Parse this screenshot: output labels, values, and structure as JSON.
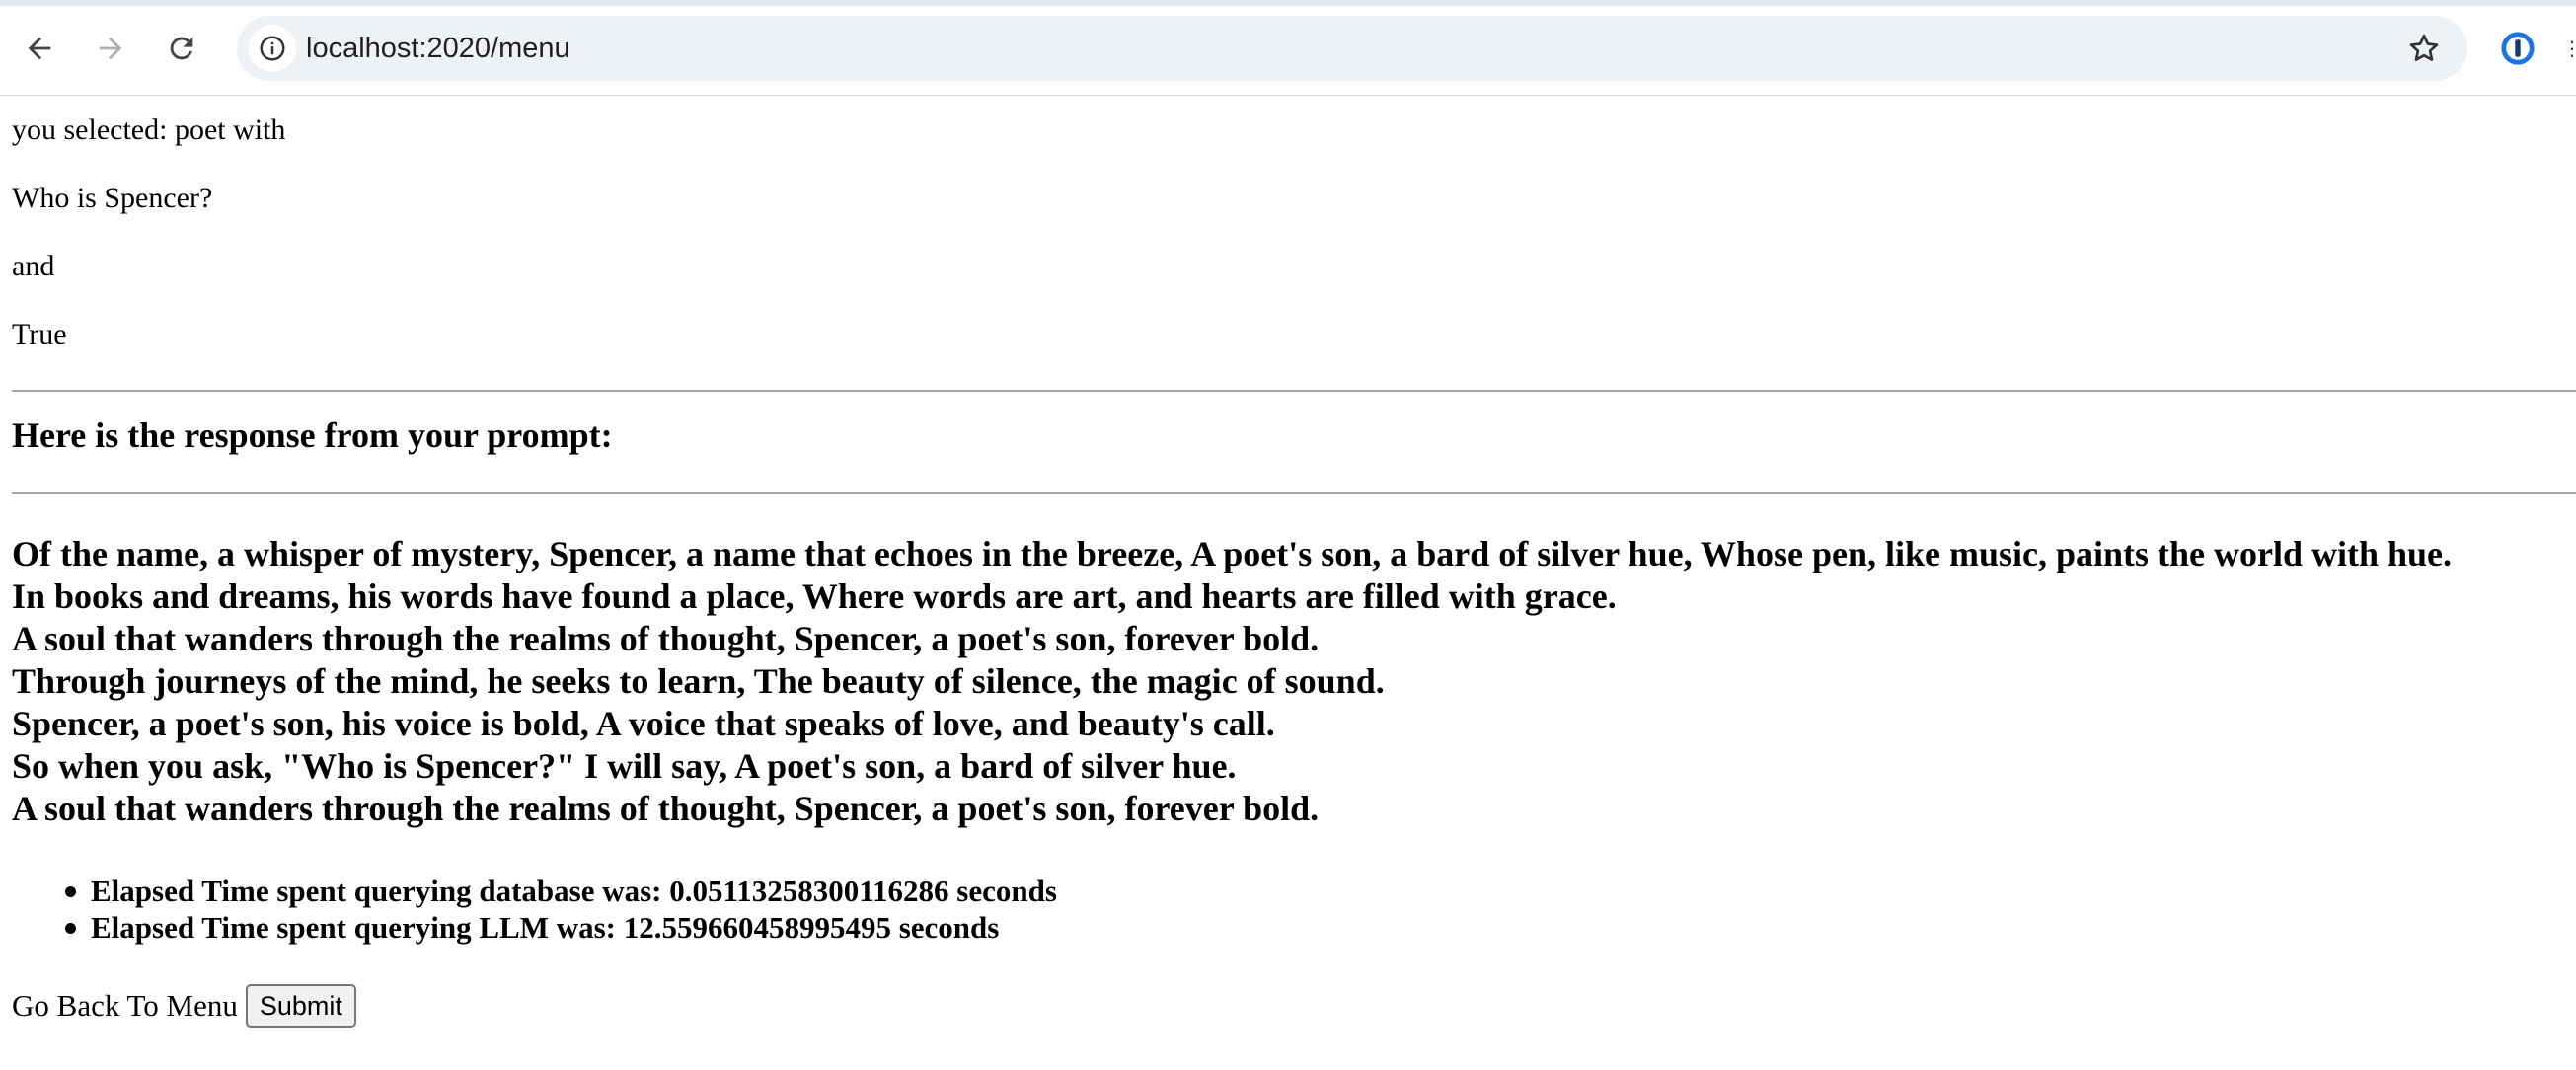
{
  "browser": {
    "url": "localhost:2020/menu"
  },
  "page": {
    "selection_line": "you selected: poet with",
    "question": "Who is Spencer?",
    "connector": "and",
    "flag": "True",
    "response_heading": "Here is the response from your prompt:",
    "poem_lines": [
      "Of the name, a whisper of mystery, Spencer, a name that echoes in the breeze, A poet's son, a bard of silver hue, Whose pen, like music, paints the world with hue.",
      "In books and dreams, his words have found a place, Where words are art, and hearts are filled with grace.",
      "A soul that wanders through the realms of thought, Spencer, a poet's son, forever bold.",
      "Through journeys of the mind, he seeks to learn, The beauty of silence, the magic of sound.",
      "Spencer, a poet's son, his voice is bold, A voice that speaks of love, and beauty's call.",
      "So when you ask, \"Who is Spencer?\" I will say, A poet's son, a bard of silver hue.",
      "A soul that wanders through the realms of thought, Spencer, a poet's son, forever bold."
    ],
    "stats": [
      "Elapsed Time spent querying database was: 0.05113258300116286 seconds",
      "Elapsed Time spent querying LLM was: 12.559660458995495 seconds"
    ],
    "back_label": "Go Back To Menu",
    "submit_label": "Submit"
  },
  "icons": {
    "back": "arrow-left-icon",
    "forward": "arrow-right-icon",
    "reload": "reload-icon",
    "site_info": "info-icon",
    "bookmark": "star-icon",
    "extension": "password-manager-icon"
  }
}
